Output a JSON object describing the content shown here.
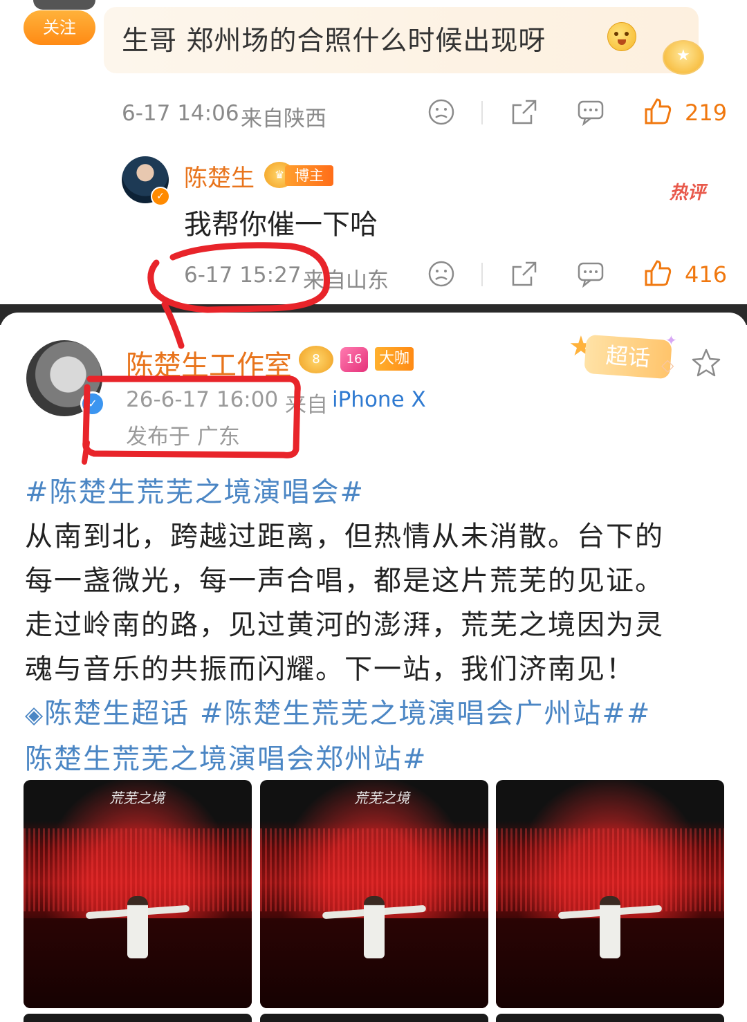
{
  "top_comment": {
    "follow_label": "关注",
    "text": "生哥 郑州场的合照什么时候出现呀",
    "timestamp": "6-17 14:06",
    "location": "来自陕西",
    "like_count": "219"
  },
  "reply": {
    "author": "陈楚生",
    "badge_label": "博主",
    "hot_label": "热评",
    "text": "我帮你催一下哈",
    "timestamp": "6-17 15:27",
    "location": "来自山东",
    "like_count": "416"
  },
  "post": {
    "author": "陈楚生工作室",
    "level_badge": "8",
    "fan_badge": "16",
    "role_badge": "大咖",
    "supertopic_label": "超话",
    "timestamp": "26-6-17 16:00",
    "source_prefix": "来自",
    "device": "iPhone X",
    "published_location": "发布于 广东",
    "hashtag_main": "#陈楚生荒芜之境演唱会#",
    "body_lines": [
      "从南到北，跨越过距离，但热情从未消散。台下的",
      "每一盏微光，每一声合唱，都是这片荒芜的见证。",
      "走过岭南的路，见过黄河的澎湃，荒芜之境因为灵",
      "魂与音乐的共振而闪耀。下一站，我们济南见！"
    ],
    "supertopic_link": "陈楚生超话",
    "hashtag_guangzhou": "#陈楚生荒芜之境演唱会广州站##",
    "hashtag_zhengzhou": "陈楚生荒芜之境演唱会郑州站#",
    "photo_logo": "荒芜之境"
  },
  "colors": {
    "accent_orange": "#f0780f",
    "name_orange": "#e8741c",
    "hashtag_blue": "#4b86c4",
    "annotation_red": "#e8242a"
  }
}
